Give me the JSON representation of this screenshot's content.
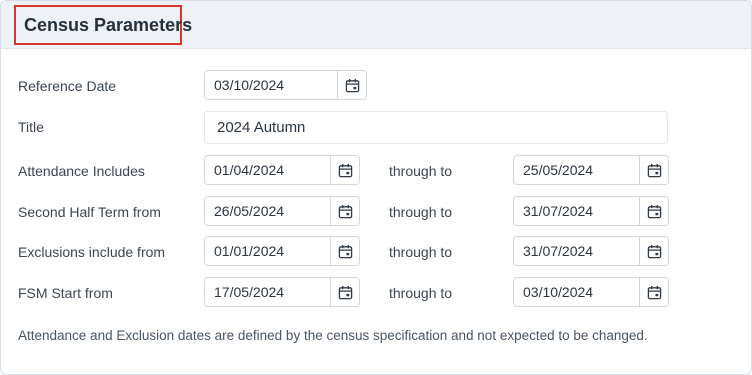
{
  "panel": {
    "title": "Census Parameters"
  },
  "fields": {
    "reference_date": {
      "label": "Reference Date",
      "value": "03/10/2024"
    },
    "title": {
      "label": "Title",
      "value": "2024 Autumn"
    },
    "attendance": {
      "label": "Attendance Includes",
      "from": "01/04/2024",
      "through_label": "through to",
      "to": "25/05/2024"
    },
    "second_half_term": {
      "label": "Second Half Term from",
      "from": "26/05/2024",
      "through_label": "through to",
      "to": "31/07/2024"
    },
    "exclusions": {
      "label": "Exclusions include from",
      "from": "01/01/2024",
      "through_label": "through to",
      "to": "31/07/2024"
    },
    "fsm_start": {
      "label": "FSM Start from",
      "from": "17/05/2024",
      "through_label": "through to",
      "to": "03/10/2024"
    }
  },
  "note": "Attendance and Exclusion dates are defined by the census specification and not expected to be changed.",
  "colors": {
    "header_bg": "#eef2f7",
    "highlight_border": "#d9352b"
  },
  "icons": {
    "date_picker": "calendar-icon"
  }
}
